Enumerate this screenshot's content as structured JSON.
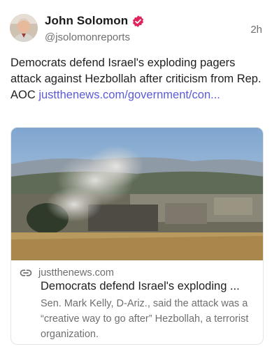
{
  "post": {
    "author": {
      "display_name": "John Solomon",
      "handle": "@jsolomonreports",
      "verified_icon": "verified-badge-icon",
      "avatar": "avatar"
    },
    "timestamp": "2h",
    "text": "Democrats defend Israel's exploding pagers attack against Hezbollah after criticism from Rep. AOC ",
    "link_text": "justthenews.com/government/con...",
    "link_card": {
      "image": "card-photo",
      "source_icon": "link-icon",
      "domain": "justthenews.com",
      "title": "Democrats defend Israel's exploding ...",
      "description": "Sen. Mark Kelly, D-Ariz., said the attack was a “creative way to go after” Hezbollah, a terrorist organization."
    }
  },
  "colors": {
    "accent": "#5b5bd6",
    "verified": "#e0245e",
    "muted_text": "#6f6f6f"
  }
}
